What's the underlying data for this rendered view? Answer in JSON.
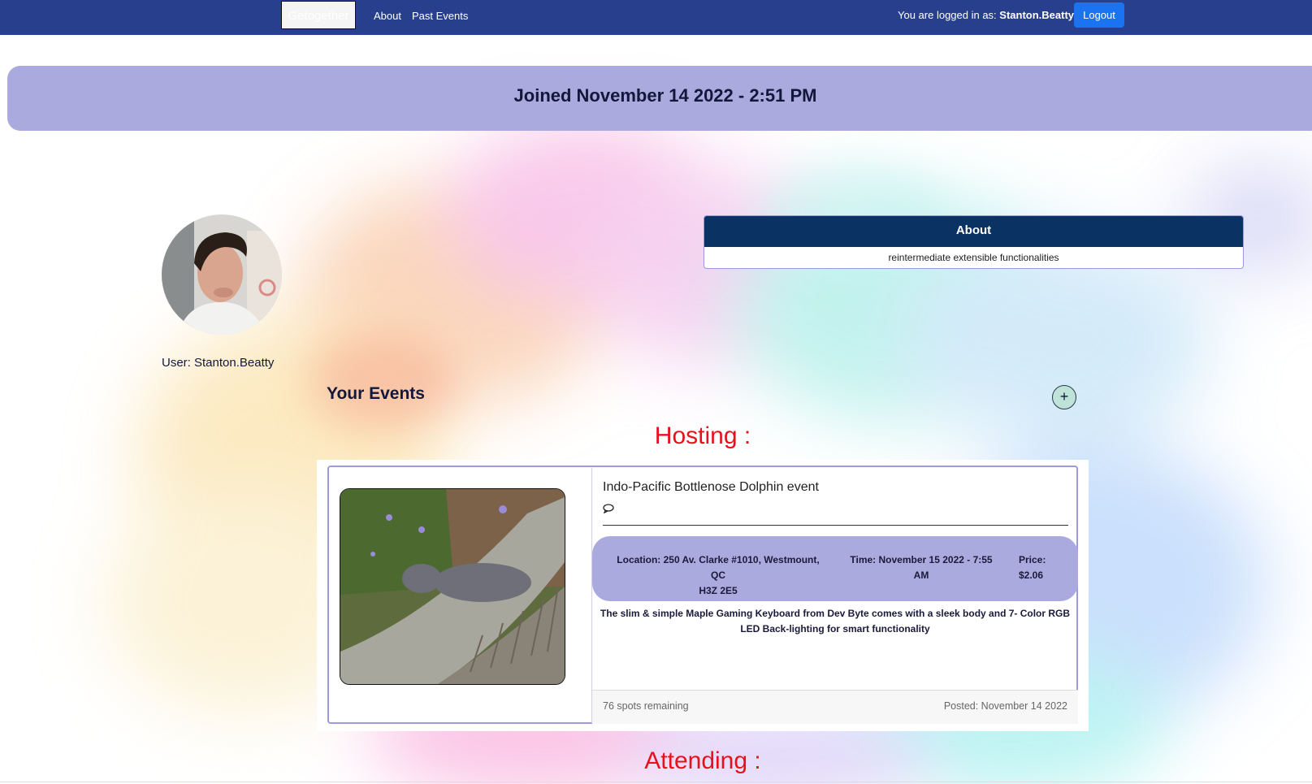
{
  "nav": {
    "brand": "Getogether",
    "links": [
      "About",
      "Past Events"
    ],
    "logged_in_prefix": "You are logged in as:",
    "username": "Stanton.Beatty",
    "separator": "|",
    "logout": "Logout"
  },
  "profile": {
    "joined": "Joined November 14 2022 - 2:51 PM",
    "user_label": "User: Stanton.Beatty",
    "about_title": "About",
    "about_text": "reintermediate extensible functionalities"
  },
  "events": {
    "section_title": "Your Events",
    "add_icon": "plus-icon",
    "add_symbol": "+",
    "hosting_label": "Hosting :",
    "attending_label": "Attending :",
    "hosting": [
      {
        "title": "Indo-Pacific Bottlenose Dolphin event",
        "comment_icon": "comment-icon",
        "location": "Location: 250 Av. Clarke #1010, Westmount, QC H3Z 2E5",
        "location_line1": "Location: 250 Av. Clarke #1010, Westmount, QC",
        "location_line2": "H3Z 2E5",
        "time_line1": "Time: November 15 2022 - 7:55",
        "time_line2": "AM",
        "price_line1": "Price:",
        "price_line2": "$2.06",
        "description": "The slim & simple Maple Gaming Keyboard from Dev Byte comes with a sleek body and 7- Color RGB LED Back-lighting for smart functionality",
        "spots": "76 spots remaining",
        "posted": "Posted: November 14 2022"
      }
    ]
  },
  "colors": {
    "navbar": "#273f8c",
    "accent_band": "#abaade",
    "about_header": "#0a3364",
    "logout": "#1a73f0",
    "section_label": "#e8111b"
  }
}
